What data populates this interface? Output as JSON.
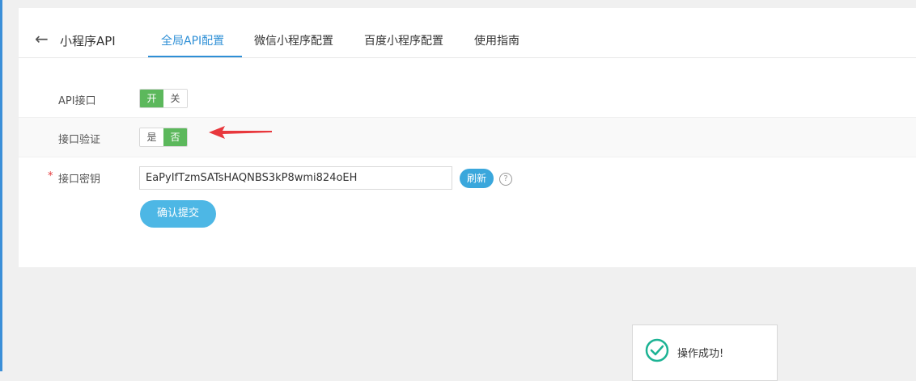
{
  "header": {
    "back_label": "←",
    "title": "小程序API"
  },
  "tabs": [
    {
      "label": "全局API配置",
      "active": true
    },
    {
      "label": "微信小程序配置",
      "active": false
    },
    {
      "label": "百度小程序配置",
      "active": false
    },
    {
      "label": "使用指南",
      "active": false
    }
  ],
  "form": {
    "api_interface": {
      "label": "API接口",
      "options": [
        "开",
        "关"
      ],
      "selected": "开"
    },
    "interface_verification": {
      "label": "接口验证",
      "options": [
        "是",
        "否"
      ],
      "selected": "否"
    },
    "interface_secret": {
      "required_mark": "*",
      "label": "接口密钥",
      "value": "EaPyIfTzmSATsHAQNBS3kP8wmi824oEH",
      "refresh_label": "刷新",
      "help_label": "?"
    },
    "submit_label": "确认提交"
  },
  "toast": {
    "message": "操作成功!",
    "icon": "check-circle-icon"
  },
  "colors": {
    "accent": "#2e8fd6",
    "switch_on": "#5cb85c",
    "refresh": "#3aa7dc",
    "submit": "#4db7e5",
    "required": "#e4393c",
    "annotation_arrow": "#e8383d",
    "toast_check": "#1cb394"
  }
}
